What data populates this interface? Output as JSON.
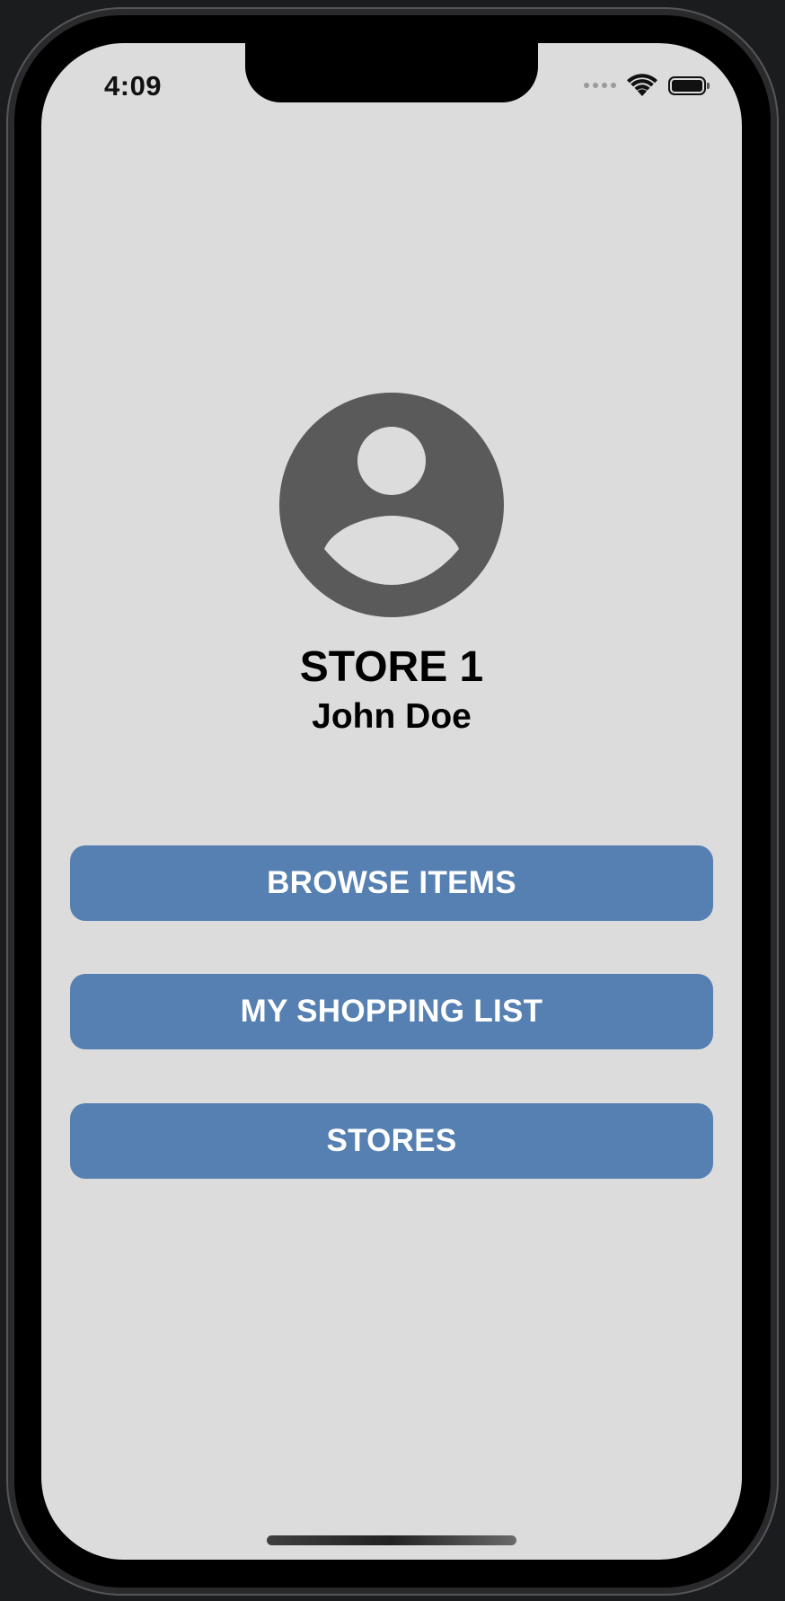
{
  "status_bar": {
    "time": "4:09",
    "wifi_icon": "wifi-icon",
    "battery_icon": "battery-icon",
    "signal_icon": "cellular-signal-icon"
  },
  "profile": {
    "avatar_icon": "person-circle-icon",
    "avatar_color": "#5a5a5a",
    "store_name": "STORE 1",
    "user_name": "John Doe"
  },
  "menu": {
    "button_color": "#5580b1",
    "browse_items_label": "BROWSE ITEMS",
    "shopping_list_label": "MY SHOPPING LIST",
    "stores_label": "STORES"
  },
  "colors": {
    "screen_background": "#dcdcdc",
    "text": "#000000"
  }
}
